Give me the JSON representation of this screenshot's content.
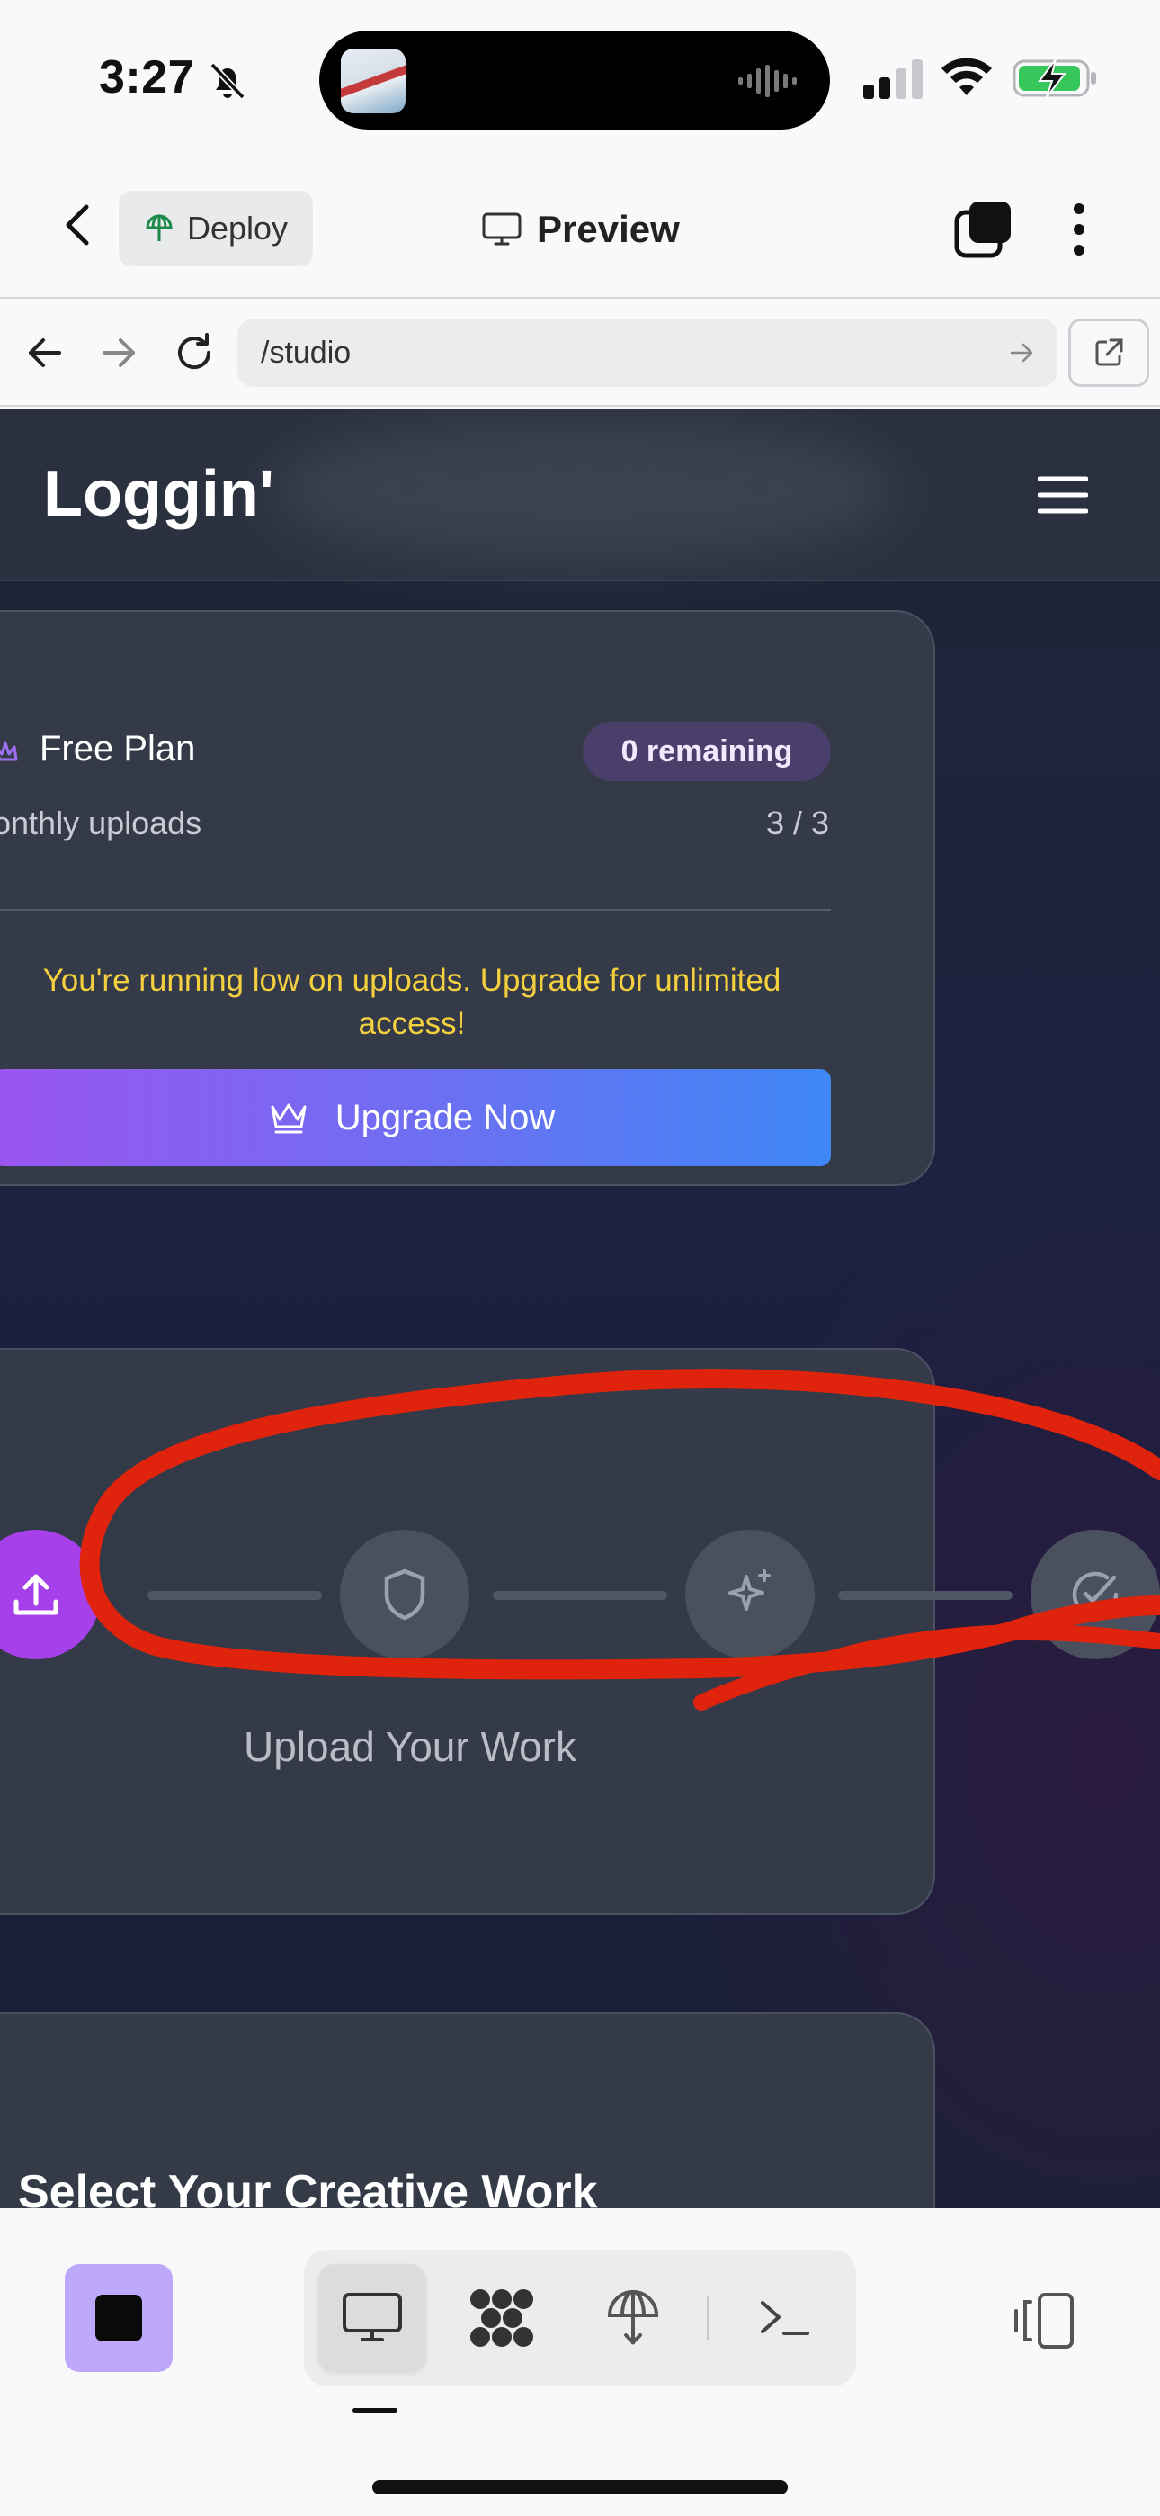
{
  "status_bar": {
    "time": "3:27",
    "icons": [
      "bell-slash-icon",
      "waveform-icon",
      "cellular-signal-icon",
      "wifi-icon",
      "battery-charging-icon"
    ]
  },
  "app_header": {
    "deploy_label": "Deploy",
    "preview_label": "Preview",
    "icons": [
      "back-chevron-icon",
      "globe-pin-icon",
      "desktop-icon",
      "tabs-icon",
      "more-vertical-icon"
    ]
  },
  "browser_bar": {
    "url": "/studio",
    "icons": [
      "arrow-left-icon",
      "arrow-right-icon",
      "reload-icon",
      "arrow-go-icon",
      "external-link-icon"
    ]
  },
  "site": {
    "title": "Loggin'",
    "plan_card": {
      "plan_name": "Free Plan",
      "remaining_badge": "0 remaining",
      "uploads_label": "onthly uploads",
      "uploads_count": "3 / 3",
      "warning_line1": "You're running low on uploads. Upgrade for unlimited",
      "warning_line2": "access!",
      "upgrade_button": "Upgrade Now"
    },
    "steps_card": {
      "steps": [
        "upload-icon",
        "shield-icon",
        "sparkle-icon",
        "check-circle-icon"
      ],
      "current_step_label": "Upload Your Work"
    },
    "select_card": {
      "title": "Select Your Creative Work"
    }
  },
  "colors": {
    "accent_purple": "#a640ea",
    "upgrade_gradient_start": "#9b55f0",
    "upgrade_gradient_end": "#3f87f5",
    "warning_yellow": "#f4d03f",
    "annotation_red": "#e0230c",
    "stop_button": "#bda8fb"
  },
  "toolbar": {
    "icons": [
      "stop-icon",
      "desktop-icon",
      "nodes-icon",
      "deploy-globe-icon",
      "terminal-icon",
      "layout-switch-icon"
    ]
  }
}
